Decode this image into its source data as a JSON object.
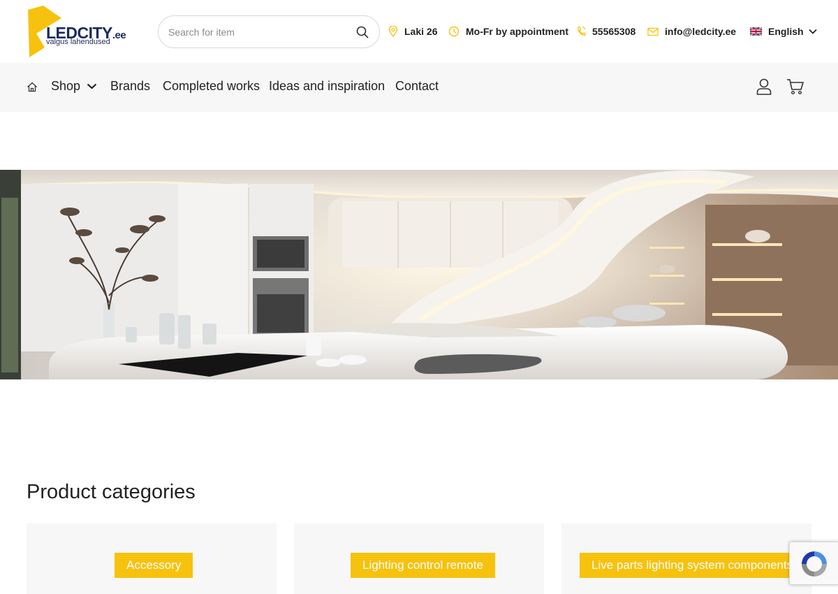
{
  "logo": {
    "name": "LEDCITY",
    "suffix": ".ee",
    "tagline": "valgus lahendused"
  },
  "search": {
    "placeholder": "Search for item"
  },
  "contact": {
    "address": "Laki 26",
    "hours": "Mo-Fr by appointment",
    "phone": "55565308",
    "email": "info@ledcity.ee"
  },
  "language": {
    "selected": "English"
  },
  "nav": {
    "items": [
      "Shop",
      "Brands",
      "Completed works",
      "Ideas and inspiration",
      "Contact"
    ]
  },
  "categories": {
    "title": "Product categories",
    "items": [
      "Accessory",
      "Lighting control remote",
      "Live parts lighting system components"
    ]
  },
  "colors": {
    "accent": "#f7c20e",
    "brand_navy": "#1b2a5e",
    "nav_bg": "#f7f7f7"
  }
}
